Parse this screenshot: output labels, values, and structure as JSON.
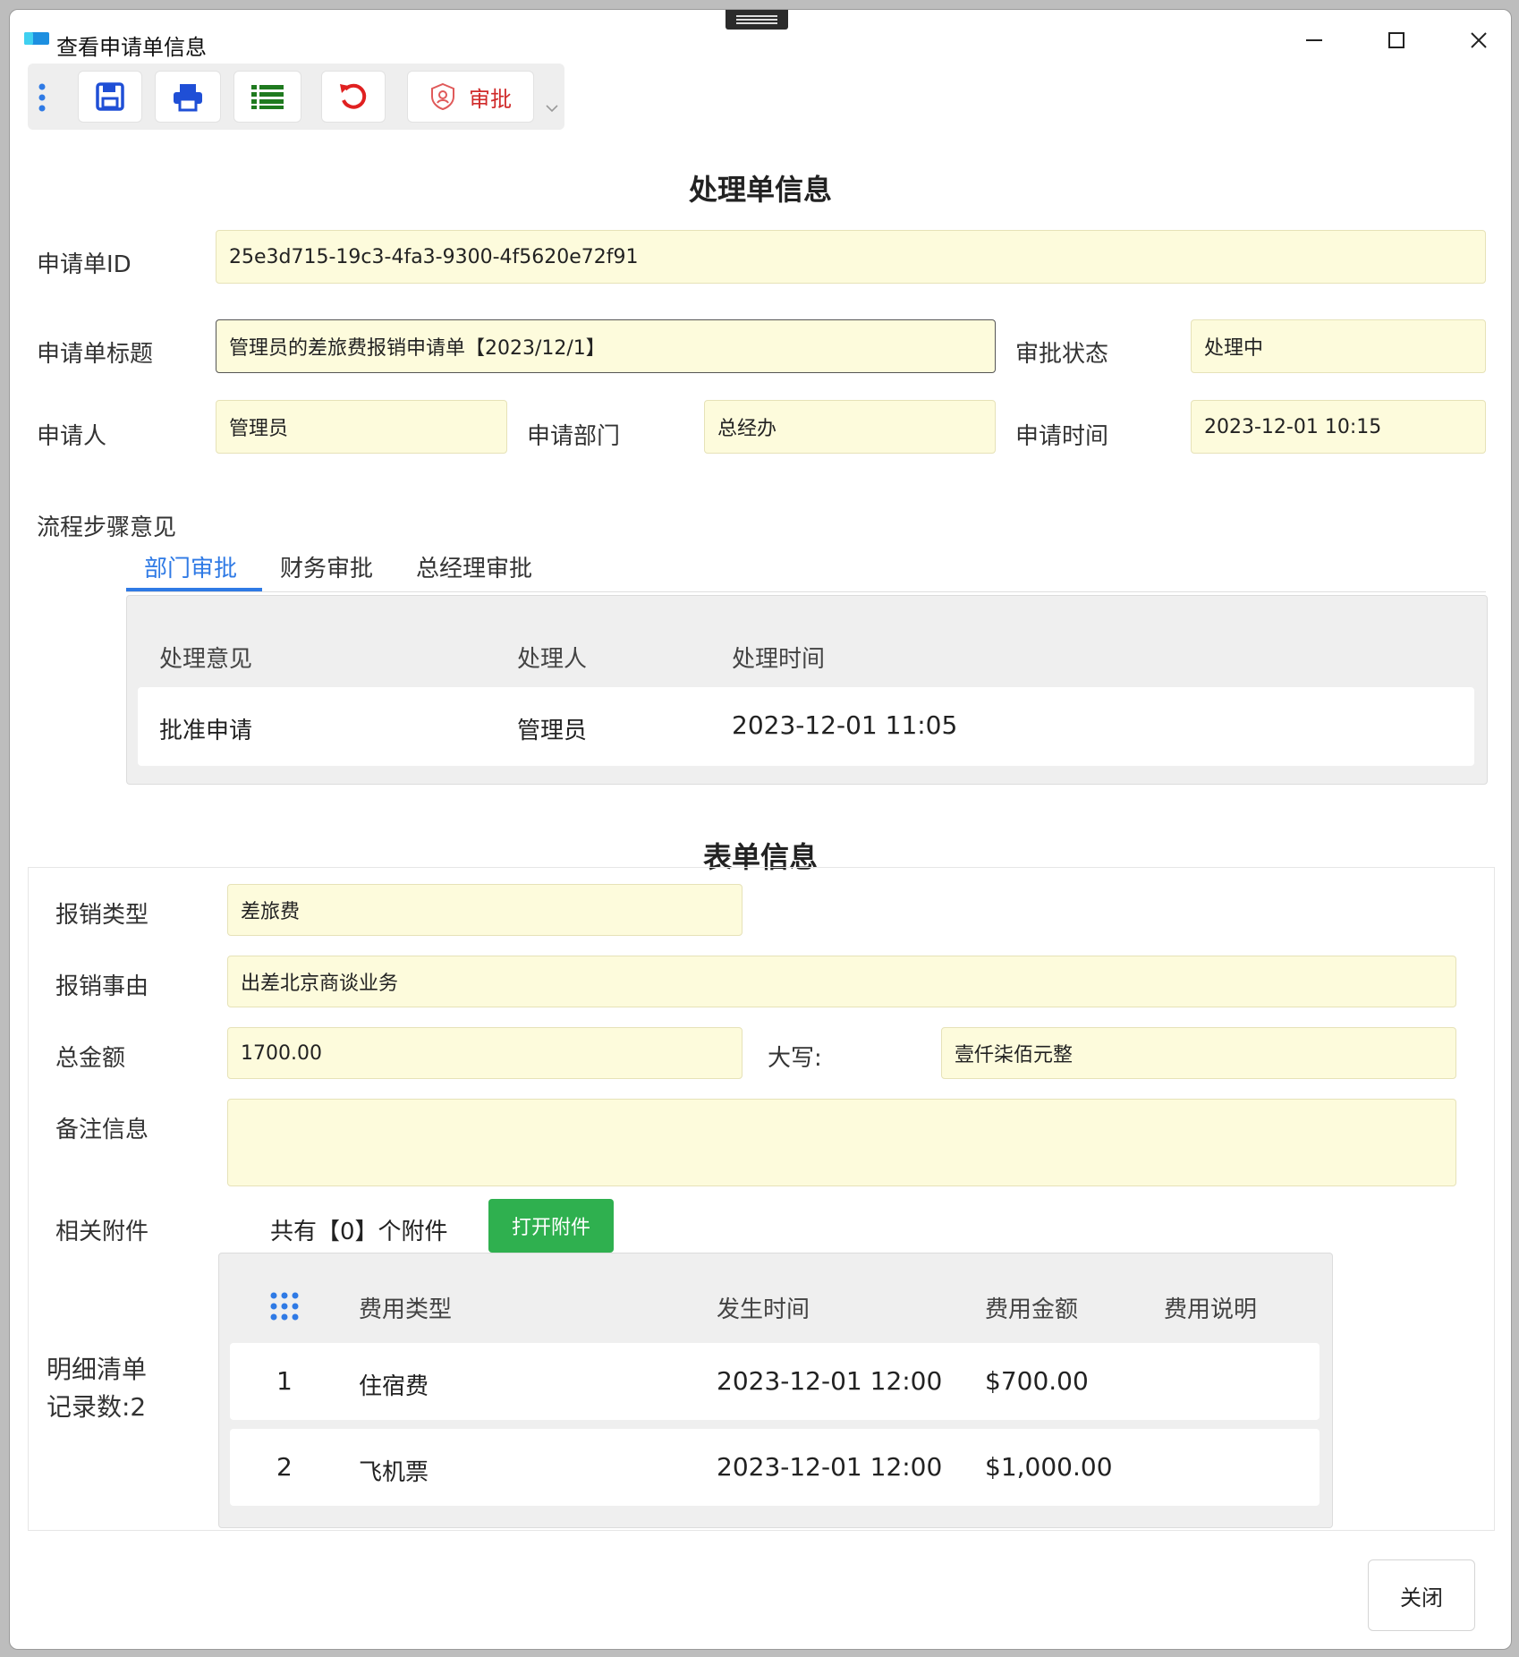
{
  "window": {
    "title": "查看申请单信息"
  },
  "toolbar": {
    "approve_label": "审批"
  },
  "process": {
    "section_title": "处理单信息",
    "id_label": "申请单ID",
    "id_value": "25e3d715-19c3-4fa3-9300-4f5620e72f91",
    "title_label": "申请单标题",
    "title_value": "管理员的差旅费报销申请单【2023/12/1】",
    "status_label": "审批状态",
    "status_value": "处理中",
    "applicant_label": "申请人",
    "applicant_value": "管理员",
    "dept_label": "申请部门",
    "dept_value": "总经办",
    "time_label": "申请时间",
    "time_value": "2023-12-01 10:15"
  },
  "steps": {
    "section_label": "流程步骤意见",
    "tabs": [
      "部门审批",
      "财务审批",
      "总经理审批"
    ],
    "active_tab": 0,
    "columns": [
      "处理意见",
      "处理人",
      "处理时间"
    ],
    "rows": [
      {
        "opinion": "批准申请",
        "handler": "管理员",
        "time": "2023-12-01 11:05"
      }
    ]
  },
  "form": {
    "section_title": "表单信息",
    "type_label": "报销类型",
    "type_value": "差旅费",
    "reason_label": "报销事由",
    "reason_value": "出差北京商谈业务",
    "total_label": "总金额",
    "total_value": "1700.00",
    "upper_label": "大写:",
    "upper_value": "壹仟柒佰元整",
    "remark_label": "备注信息",
    "remark_value": "",
    "attach_label": "相关附件",
    "attach_count_text": "共有【0】个附件",
    "open_attach_label": "打开附件",
    "detail_label": "明细清单",
    "record_count_text": "记录数:2",
    "detail_columns": [
      "费用类型",
      "发生时间",
      "费用金额",
      "费用说明"
    ],
    "detail_rows": [
      {
        "no": "1",
        "type": "住宿费",
        "time": "2023-12-01 12:00",
        "amount": "$700.00",
        "note": ""
      },
      {
        "no": "2",
        "type": "飞机票",
        "time": "2023-12-01 12:00",
        "amount": "$1,000.00",
        "note": ""
      }
    ]
  },
  "footer": {
    "close_label": "关闭"
  },
  "colors": {
    "accent": "#2f7ae5",
    "field_bg": "#fdfbdc",
    "green": "#2fb04f",
    "red": "#e02020",
    "blue": "#1f4fd6",
    "dark_green": "#1f7a1f"
  }
}
